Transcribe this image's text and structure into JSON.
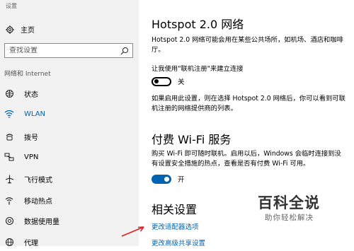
{
  "window": {
    "title": "设置"
  },
  "sidebar": {
    "home_label": "主页",
    "search_placeholder": "查找设置",
    "section_label": "网络和 Internet",
    "items": [
      {
        "label": "状态",
        "icon": "status-globe-icon",
        "active": false
      },
      {
        "label": "WLAN",
        "icon": "wifi-icon",
        "active": true
      },
      {
        "label": "拨号",
        "icon": "dialup-icon",
        "active": false
      },
      {
        "label": "VPN",
        "icon": "vpn-icon",
        "active": false
      },
      {
        "label": "飞行模式",
        "icon": "airplane-icon",
        "active": false
      },
      {
        "label": "移动热点",
        "icon": "hotspot-icon",
        "active": false
      },
      {
        "label": "数据使用量",
        "icon": "data-usage-icon",
        "active": false
      },
      {
        "label": "代理",
        "icon": "globe-icon",
        "active": false
      }
    ]
  },
  "main": {
    "hotspot": {
      "title": "Hotspot 2.0 网络",
      "desc": "Hotspot 2.0 网络可能会用在某些公共场所，如机场、酒店和咖啡厅。",
      "toggle_label": "让我使用\"联机注册\"来建立连接",
      "toggle_state": "关",
      "note": "如果启用此设置，则在选择 Hotspot 2.0 网络后，你可以看到可联机注册的网络提供商的列表。"
    },
    "paid_wifi": {
      "title": "付费 Wi-Fi 服务",
      "desc": "购买 Wi-Fi 即可随时联机。启用以后，Windows 会临时连接到没有设置安全措施的热点，查看是否有付费 Wi-Fi 可用。",
      "toggle_state": "开"
    },
    "related": {
      "title": "相关设置",
      "links": [
        "更改适配器选项",
        "更改高级共享设置"
      ]
    }
  },
  "watermark": {
    "big": "百科全说",
    "small": "助你轻松解决"
  },
  "colors": {
    "accent": "#0063b1",
    "sidebar_bg": "#f2f2f2"
  }
}
